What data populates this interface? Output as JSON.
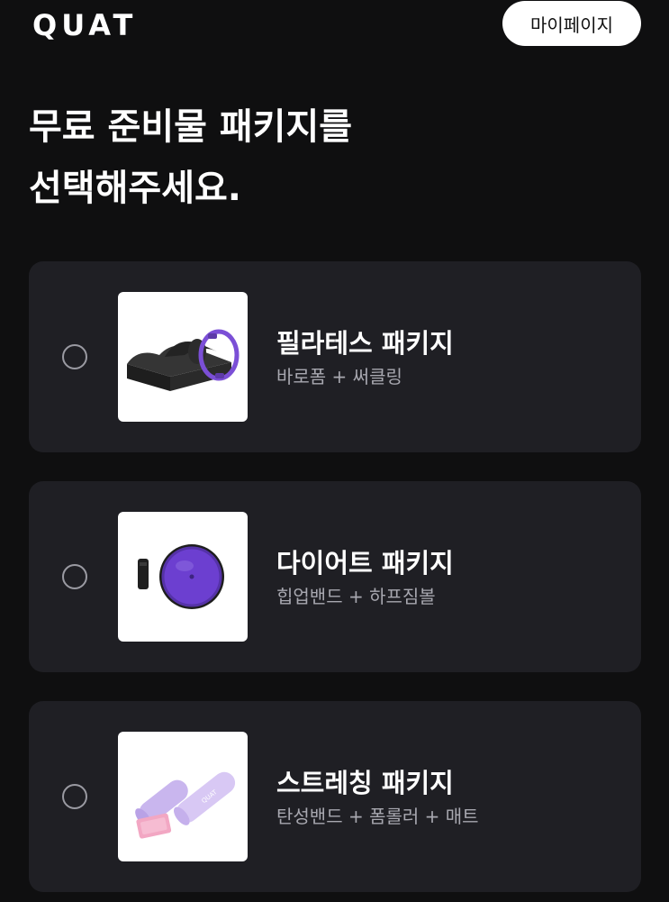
{
  "header": {
    "logo": "QUAT",
    "mypage_label": "마이페이지"
  },
  "main": {
    "title_line1": "무료 준비물 패키지를",
    "title_line2": "선택해주세요."
  },
  "packages": [
    {
      "name": "필라테스 패키지",
      "items": "바로폼 + 써클링",
      "selected": false,
      "image": "pilates-equipment-image"
    },
    {
      "name": "다이어트 패키지",
      "items": "힙업밴드 + 하프짐볼",
      "selected": false,
      "image": "diet-equipment-image"
    },
    {
      "name": "스트레칭 패키지",
      "items": "탄성밴드 + 폼롤러 + 매트",
      "selected": false,
      "image": "stretching-equipment-image"
    }
  ],
  "product_brand_mark": "QUAT",
  "colors": {
    "background": "#0f0f10",
    "card": "#1f1f24",
    "accent_purple": "#7b4fd6",
    "subtext": "#a8a8b0"
  }
}
